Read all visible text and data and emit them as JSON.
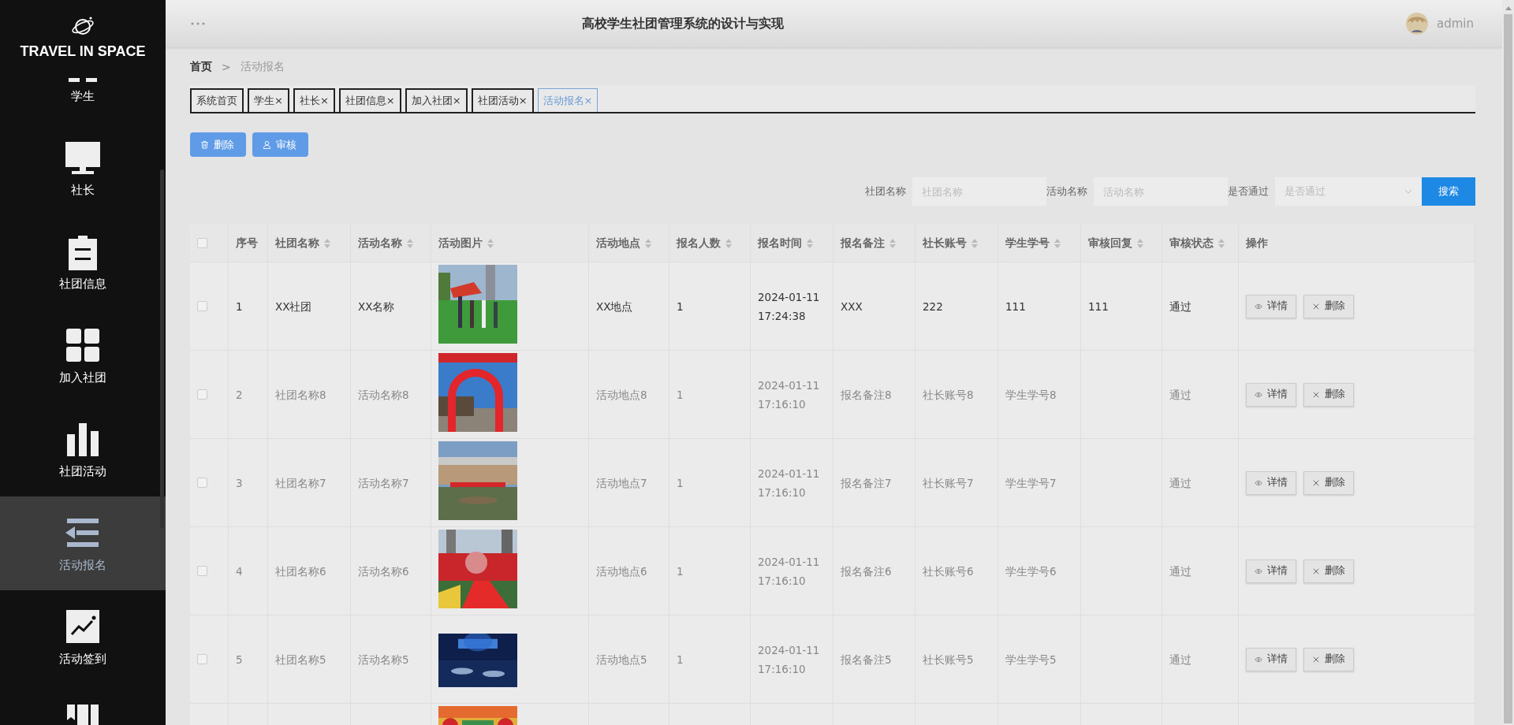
{
  "sidebar": {
    "logo": "TRAVEL IN SPACE",
    "items": [
      {
        "label": "学生",
        "selected": false
      },
      {
        "label": "社长",
        "selected": false
      },
      {
        "label": "社团信息",
        "selected": false
      },
      {
        "label": "加入社团",
        "selected": false
      },
      {
        "label": "社团活动",
        "selected": false
      },
      {
        "label": "活动报名",
        "selected": true
      },
      {
        "label": "活动签到",
        "selected": false
      },
      {
        "selected": false
      }
    ]
  },
  "header": {
    "title": "高校学生社团管理系统的设计与实现",
    "user": "admin"
  },
  "breadcrumb": {
    "items": [
      "首页",
      "活动报名"
    ],
    "separator": ">"
  },
  "tabs": [
    {
      "label": "系统首页",
      "selected": false
    },
    {
      "label": "学生",
      "close": "×",
      "selected": false
    },
    {
      "label": "社长",
      "close": "×",
      "selected": false
    },
    {
      "label": "社团信息",
      "close": "×",
      "selected": false
    },
    {
      "label": "加入社团",
      "close": "×",
      "selected": false
    },
    {
      "label": "社团活动",
      "close": "×",
      "selected": false
    },
    {
      "label": "活动报名",
      "close": "×",
      "selected": true
    }
  ],
  "toolbar": [
    {
      "label": "删除",
      "kind": "delete"
    },
    {
      "label": "审核",
      "kind": "review"
    }
  ],
  "search": {
    "fields": [
      {
        "label": "社团名称",
        "placeholder": "社团名称",
        "kind": "input"
      },
      {
        "label": "活动名称",
        "placeholder": "活动名称",
        "kind": "input"
      },
      {
        "label": "是否通过",
        "placeholder": "是否通过",
        "kind": "select"
      }
    ],
    "button": "搜索"
  },
  "table": {
    "header_checked": false,
    "columns": [
      {
        "label": "序号",
        "sortable": false
      },
      {
        "label": "社团名称",
        "sortable": true
      },
      {
        "label": "活动名称",
        "sortable": true
      },
      {
        "label": "活动图片",
        "sortable": true
      },
      {
        "label": "活动地点",
        "sortable": true
      },
      {
        "label": "报名人数",
        "sortable": true
      },
      {
        "label": "报名时间",
        "sortable": true
      },
      {
        "label": "报名备注",
        "sortable": true
      },
      {
        "label": "社长账号",
        "sortable": true
      },
      {
        "label": "学生学号",
        "sortable": true
      },
      {
        "label": "审核回复",
        "sortable": true
      },
      {
        "label": "审核状态",
        "sortable": true
      },
      {
        "label": "操作",
        "sortable": false
      }
    ],
    "rows": [
      {
        "checked": false,
        "image": {
          "kind": "picture"
        },
        "cells": [
          "1",
          "XX社团",
          "XX名称",
          "XX地点",
          "1",
          "2024-01-11 17:24:38",
          "XXX",
          "222",
          "111",
          "111",
          "通过"
        ],
        "actions": [
          {
            "label": "详情",
            "kind": "view"
          },
          {
            "label": "删除",
            "kind": "delete"
          }
        ]
      },
      {
        "checked": false,
        "image": {
          "kind": "picture"
        },
        "cells": [
          "2",
          "社团名称8",
          "活动名称8",
          "活动地点8",
          "1",
          "2024-01-11 17:16:10",
          "报名备注8",
          "社长账号8",
          "学生学号8",
          null,
          "通过"
        ],
        "actions": [
          {
            "label": "详情",
            "kind": "view"
          },
          {
            "label": "删除",
            "kind": "delete"
          }
        ]
      },
      {
        "checked": false,
        "image": {
          "kind": "picture"
        },
        "cells": [
          "3",
          "社团名称7",
          "活动名称7",
          "活动地点7",
          "1",
          "2024-01-11 17:16:10",
          "报名备注7",
          "社长账号7",
          "学生学号7",
          null,
          "通过"
        ],
        "actions": [
          {
            "label": "详情",
            "kind": "view"
          },
          {
            "label": "删除",
            "kind": "delete"
          }
        ]
      },
      {
        "checked": false,
        "image": {
          "kind": "picture"
        },
        "cells": [
          "4",
          "社团名称6",
          "活动名称6",
          "活动地点6",
          "1",
          "2024-01-11 17:16:10",
          "报名备注6",
          "社长账号6",
          "学生学号6",
          null,
          "通过"
        ],
        "actions": [
          {
            "label": "详情",
            "kind": "view"
          },
          {
            "label": "删除",
            "kind": "delete"
          }
        ]
      },
      {
        "checked": false,
        "image": {
          "kind": "picture"
        },
        "cells": [
          "5",
          "社团名称5",
          "活动名称5",
          "活动地点5",
          "1",
          "2024-01-11 17:16:10",
          "报名备注5",
          "社长账号5",
          "学生学号5",
          null,
          "通过"
        ],
        "actions": [
          {
            "label": "详情",
            "kind": "view"
          },
          {
            "label": "删除",
            "kind": "delete"
          }
        ]
      },
      {
        "image": {
          "kind": "picture"
        }
      }
    ]
  }
}
